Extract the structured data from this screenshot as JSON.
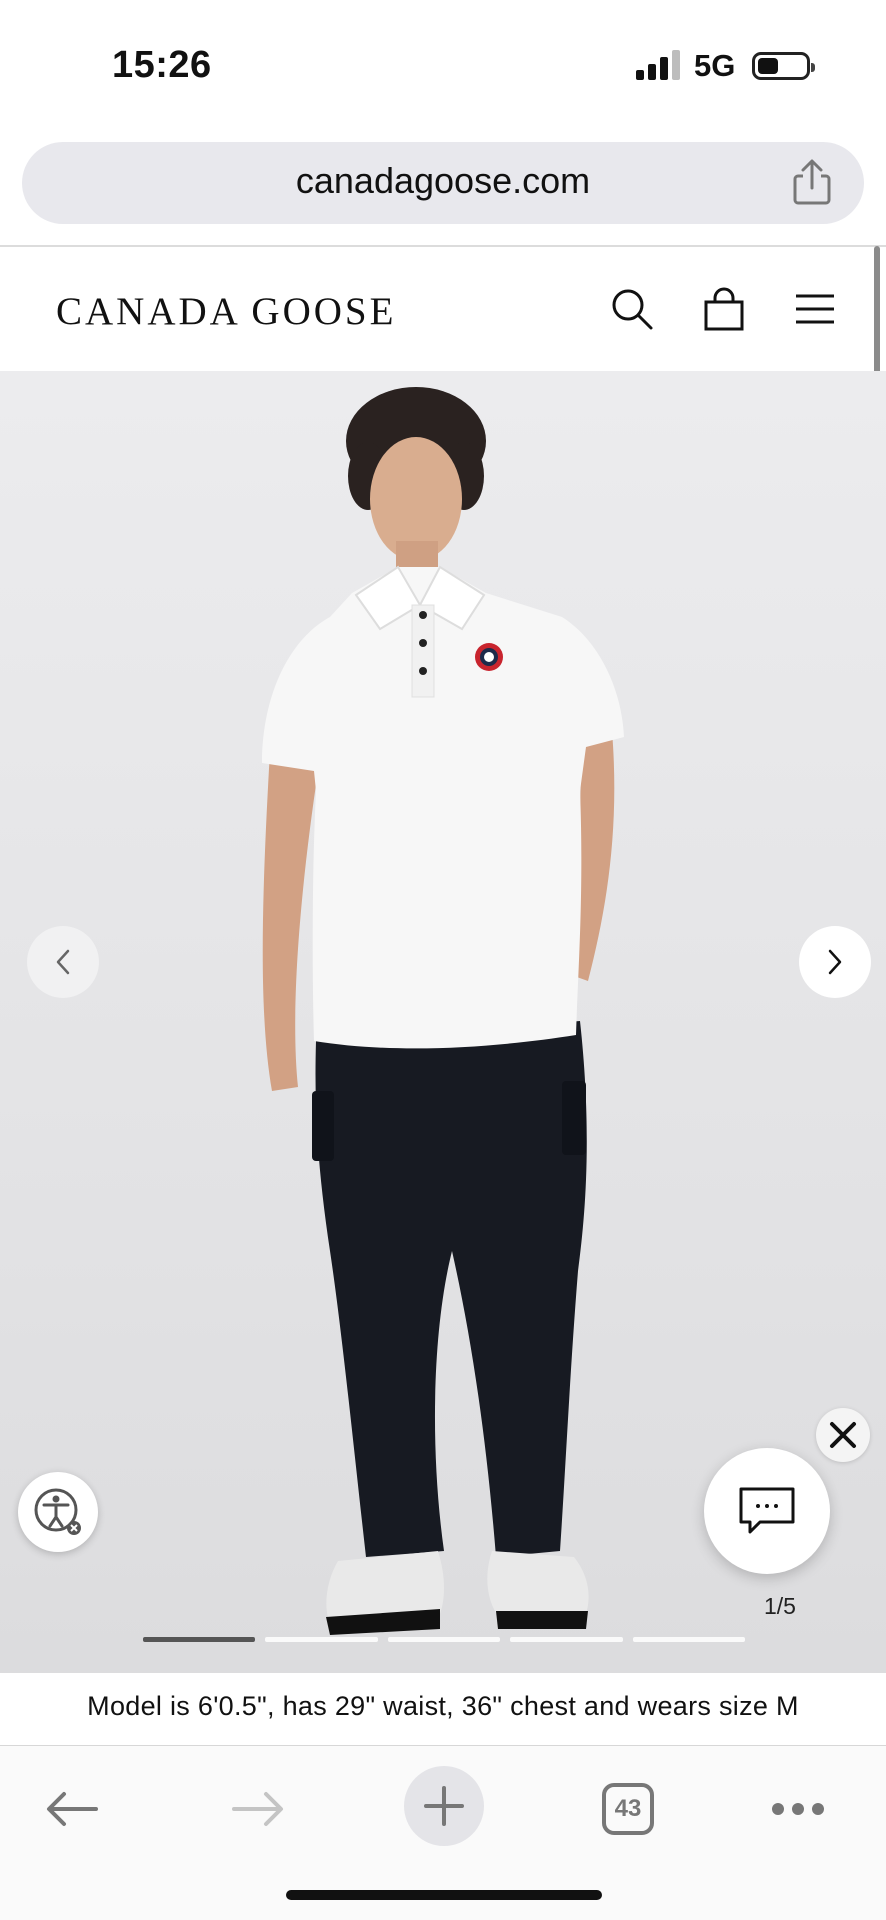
{
  "status_bar": {
    "time": "15:26",
    "network": "5G",
    "signal_icon": "cellular-signal-icon",
    "battery_icon": "battery-icon"
  },
  "browser": {
    "url": "canadagoose.com",
    "share_icon": "share-icon",
    "toolbar": {
      "back_icon": "arrow-left-icon",
      "forward_icon": "arrow-right-icon",
      "new_tab_icon": "plus-icon",
      "tab_count": "43",
      "more_icon": "ellipsis-icon"
    }
  },
  "site_header": {
    "logo": "CANADA GOOSE",
    "icons": [
      "search-icon",
      "shopping-bag-icon",
      "hamburger-menu-icon"
    ]
  },
  "gallery": {
    "image_alt_icon": "product-image",
    "current_index": 1,
    "total": 5,
    "counter_text": "1/5",
    "prev_icon": "chevron-left-icon",
    "next_icon": "chevron-right-icon",
    "close_icon": "close-icon",
    "chat_icon": "chat-bubble-icon",
    "accessibility_icon": "accessibility-icon",
    "progress_segments": 5,
    "active_segment": 1
  },
  "caption": {
    "text": "Model is 6'0.5\", has 29\" waist, 36\" chest and wears size M"
  },
  "colors": {
    "gallery_bg": "#e6e6e8",
    "address_bar_bg": "#e8e8ed",
    "text": "#111111"
  }
}
